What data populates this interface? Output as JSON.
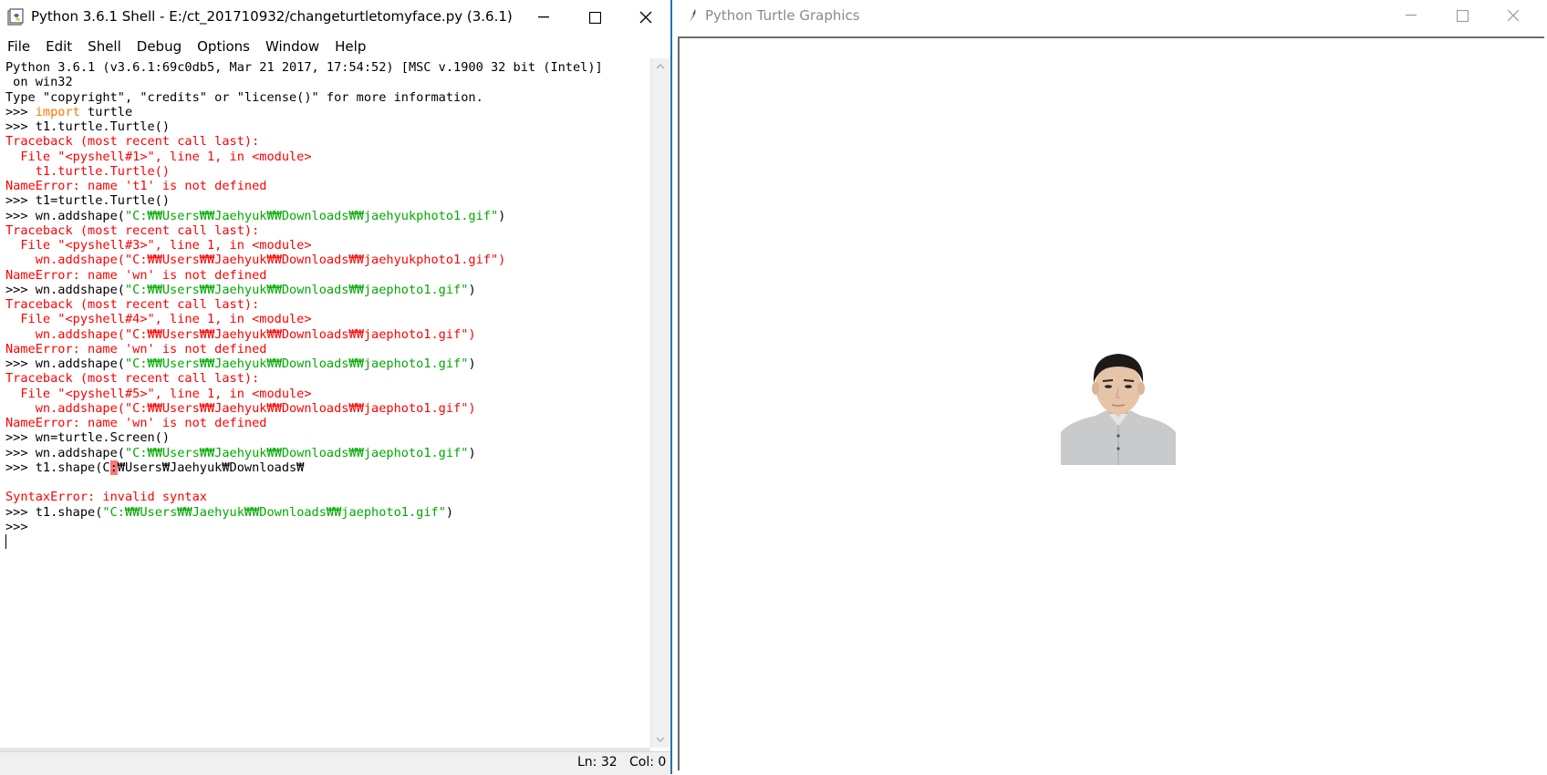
{
  "shell": {
    "title": "Python 3.6.1 Shell - E:/ct_201710932/changeturtletomyface.py (3.6.1)",
    "menu": [
      "File",
      "Edit",
      "Shell",
      "Debug",
      "Options",
      "Window",
      "Help"
    ],
    "lines": [
      [
        {
          "t": "Python 3.6.1 (v3.6.1:69c0db5, Mar 21 2017, 17:54:52) [MSC v.1900 32 bit (Intel)]"
        }
      ],
      [
        {
          "t": " on win32"
        }
      ],
      [
        {
          "t": "Type \"copyright\", \"credits\" or \"license()\" for more information."
        }
      ],
      [
        {
          "t": ">>> "
        },
        {
          "t": "import",
          "c": "kw"
        },
        {
          "t": " turtle"
        }
      ],
      [
        {
          "t": ">>> t1.turtle.Turtle()"
        }
      ],
      [
        {
          "t": "Traceback (most recent call last):",
          "c": "err"
        }
      ],
      [
        {
          "t": "  File \"<pyshell#1>\", line 1, in <module>",
          "c": "err"
        }
      ],
      [
        {
          "t": "    t1.turtle.Turtle()",
          "c": "err"
        }
      ],
      [
        {
          "t": "NameError: name 't1' is not defined",
          "c": "err"
        }
      ],
      [
        {
          "t": ">>> t1=turtle.Turtle()"
        }
      ],
      [
        {
          "t": ">>> wn.addshape("
        },
        {
          "t": "\"C:₩₩Users₩₩Jaehyuk₩₩Downloads₩₩jaehyukphoto1.gif\"",
          "c": "str"
        },
        {
          "t": ")"
        }
      ],
      [
        {
          "t": "Traceback (most recent call last):",
          "c": "err"
        }
      ],
      [
        {
          "t": "  File \"<pyshell#3>\", line 1, in <module>",
          "c": "err"
        }
      ],
      [
        {
          "t": "    wn.addshape(\"C:₩₩Users₩₩Jaehyuk₩₩Downloads₩₩jaehyukphoto1.gif\")",
          "c": "err"
        }
      ],
      [
        {
          "t": "NameError: name 'wn' is not defined",
          "c": "err"
        }
      ],
      [
        {
          "t": ">>> wn.addshape("
        },
        {
          "t": "\"C:₩₩Users₩₩Jaehyuk₩₩Downloads₩₩jaephoto1.gif\"",
          "c": "str"
        },
        {
          "t": ")"
        }
      ],
      [
        {
          "t": "Traceback (most recent call last):",
          "c": "err"
        }
      ],
      [
        {
          "t": "  File \"<pyshell#4>\", line 1, in <module>",
          "c": "err"
        }
      ],
      [
        {
          "t": "    wn.addshape(\"C:₩₩Users₩₩Jaehyuk₩₩Downloads₩₩jaephoto1.gif\")",
          "c": "err"
        }
      ],
      [
        {
          "t": "NameError: name 'wn' is not defined",
          "c": "err"
        }
      ],
      [
        {
          "t": ">>> wn.addshape("
        },
        {
          "t": "\"C:₩₩Users₩₩Jaehyuk₩₩Downloads₩₩jaephoto1.gif\"",
          "c": "str"
        },
        {
          "t": ")"
        }
      ],
      [
        {
          "t": "Traceback (most recent call last):",
          "c": "err"
        }
      ],
      [
        {
          "t": "  File \"<pyshell#5>\", line 1, in <module>",
          "c": "err"
        }
      ],
      [
        {
          "t": "    wn.addshape(\"C:₩₩Users₩₩Jaehyuk₩₩Downloads₩₩jaephoto1.gif\")",
          "c": "err"
        }
      ],
      [
        {
          "t": "NameError: name 'wn' is not defined",
          "c": "err"
        }
      ],
      [
        {
          "t": ">>> wn=turtle.Screen()"
        }
      ],
      [
        {
          "t": ">>> wn.addshape("
        },
        {
          "t": "\"C:₩₩Users₩₩Jaehyuk₩₩Downloads₩₩jaephoto1.gif\"",
          "c": "str"
        },
        {
          "t": ")"
        }
      ],
      [
        {
          "t": ">>> t1.shape(C"
        },
        {
          "t": ":",
          "c": "hl"
        },
        {
          "t": "₩Users₩Jaehyuk₩Downloads₩"
        }
      ],
      [
        {
          "t": ""
        }
      ],
      [
        {
          "t": "SyntaxError: invalid syntax",
          "c": "err"
        }
      ],
      [
        {
          "t": ">>> t1.shape("
        },
        {
          "t": "\"C:₩₩Users₩₩Jaehyuk₩₩Downloads₩₩jaephoto1.gif\"",
          "c": "str"
        },
        {
          "t": ")"
        }
      ],
      [
        {
          "t": ">>> "
        }
      ]
    ],
    "status": {
      "ln": "Ln: 32",
      "col": "Col: 0"
    },
    "icons": [
      "idle-app-icon",
      "minimize-icon",
      "maximize-icon",
      "close-icon",
      "scroll-up-icon",
      "scroll-down-icon"
    ]
  },
  "turtle": {
    "title": "Python Turtle Graphics",
    "icons": [
      "tk-feather-icon",
      "minimize-icon",
      "maximize-icon",
      "close-icon"
    ],
    "image": "portrait-photo"
  },
  "colors": {
    "keyword": "#ff7700",
    "string": "#00aa00",
    "error": "#ff0000",
    "error_highlight": "#ff7777",
    "shell_border": "#2b6fb0"
  }
}
